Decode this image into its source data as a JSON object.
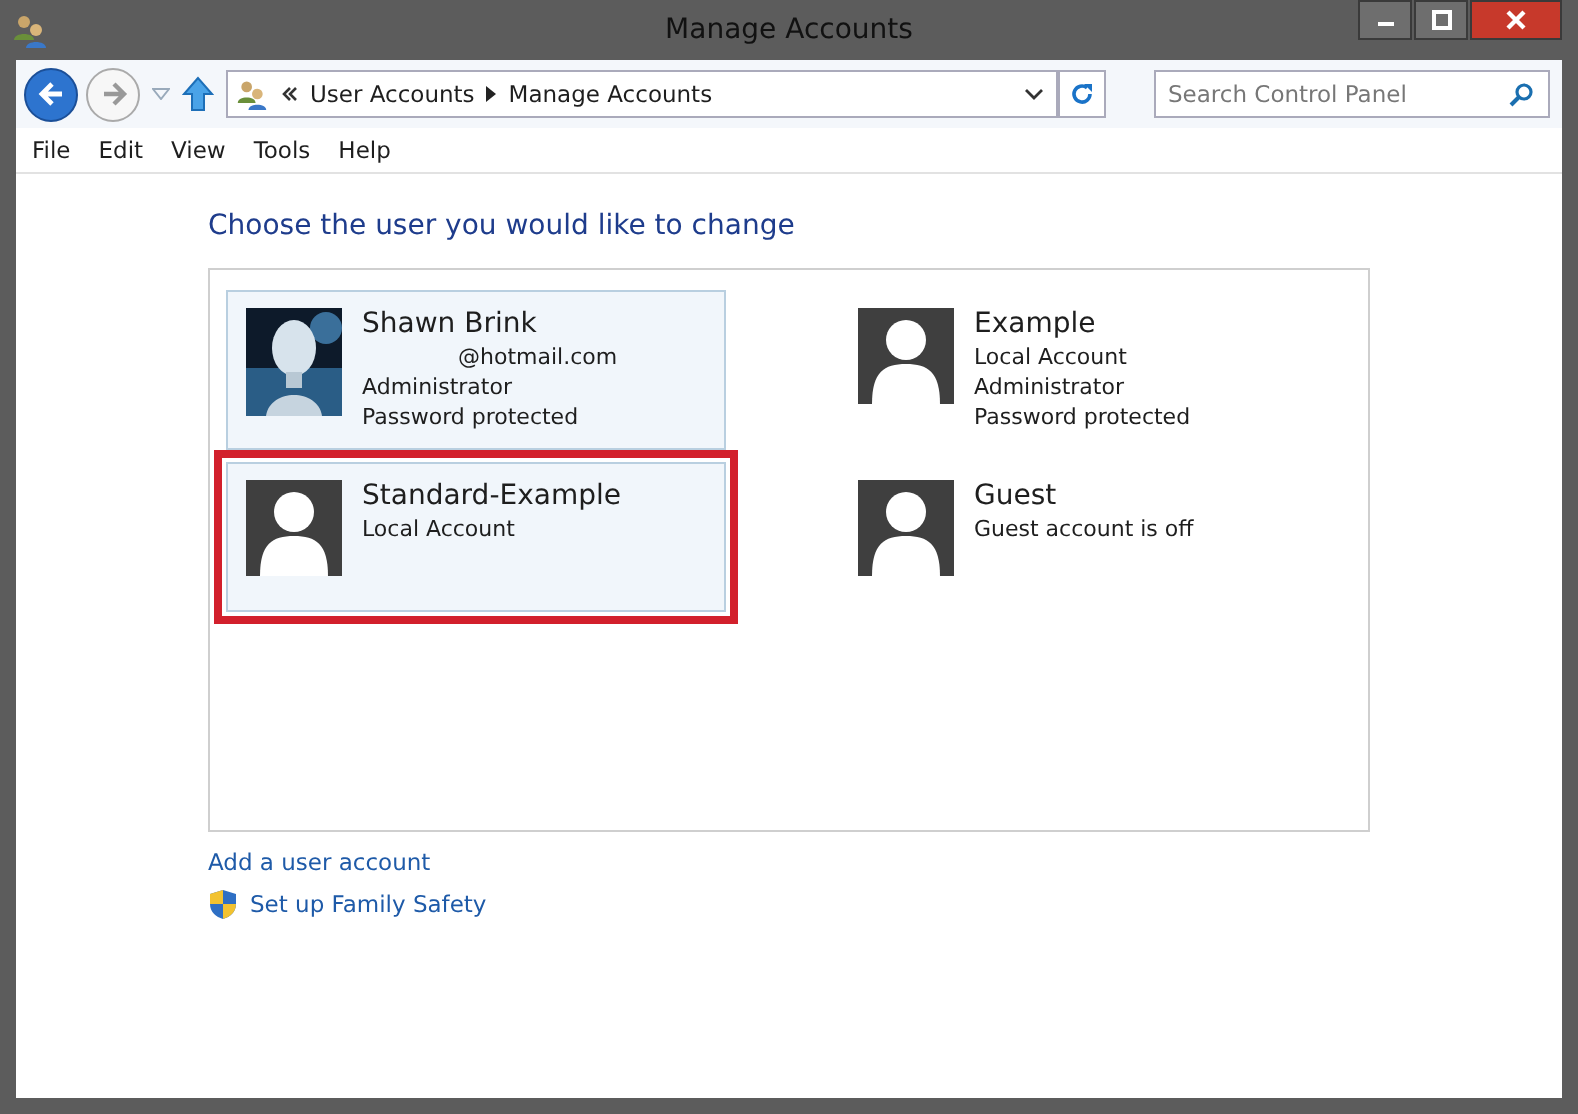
{
  "window": {
    "title": "Manage Accounts"
  },
  "address_bar": {
    "crumbs": [
      "User Accounts",
      "Manage Accounts"
    ]
  },
  "search": {
    "placeholder": "Search Control Panel"
  },
  "menu": [
    "File",
    "Edit",
    "View",
    "Tools",
    "Help"
  ],
  "heading": "Choose the user you would like to change",
  "accounts": [
    {
      "name": "Shawn Brink",
      "details": [
        "@hotmail.com",
        "Administrator",
        "Password protected"
      ],
      "highlighted": true,
      "annotated": false
    },
    {
      "name": "Example",
      "details": [
        "Local Account",
        "Administrator",
        "Password protected"
      ],
      "kind": "default",
      "highlighted": false,
      "annotated": false
    },
    {
      "name": "Standard-Example",
      "details": [
        "Local Account"
      ],
      "kind": "default",
      "highlighted": true,
      "annotated": true
    },
    {
      "name": "Guest",
      "details": [
        "Guest account is off"
      ],
      "kind": "default",
      "highlighted": false,
      "annotated": false
    }
  ],
  "links": [
    {
      "text": "Add a user account",
      "kind": "plain"
    },
    {
      "text": "Set up Family Safety",
      "kind": "shield"
    }
  ]
}
